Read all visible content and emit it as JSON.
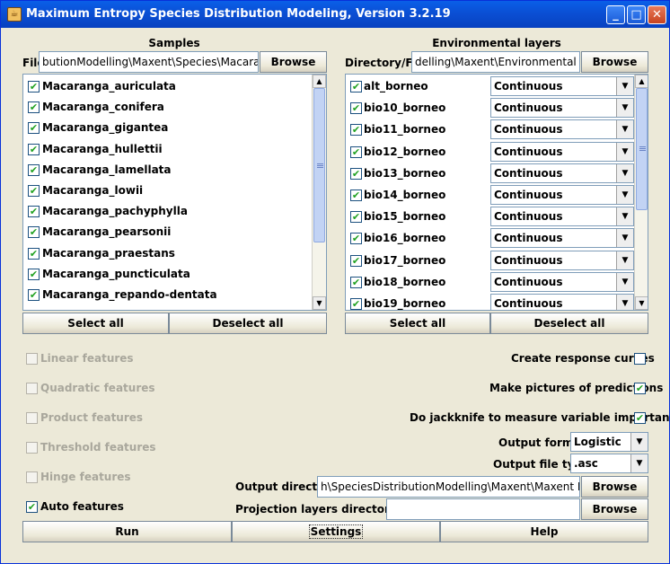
{
  "window": {
    "title": "Maximum Entropy Species Distribution Modeling, Version 3.2.19",
    "title_icon": "java-cup-icon",
    "controls": {
      "minimize": "_",
      "maximize": "□",
      "close": "✕"
    }
  },
  "samples": {
    "title": "Samples",
    "file_label": "File",
    "file_value": "butionModelling\\Maxent\\Species\\Macaranga.c",
    "browse": "Browse",
    "items": [
      "Macaranga_auriculata",
      "Macaranga_conifera",
      "Macaranga_gigantea",
      "Macaranga_hullettii",
      "Macaranga_lamellata",
      "Macaranga_lowii",
      "Macaranga_pachyphylla",
      "Macaranga_pearsonii",
      "Macaranga_praestans",
      "Macaranga_puncticulata",
      "Macaranga_repando-dentata"
    ],
    "select_all": "Select all",
    "deselect_all": "Deselect all"
  },
  "env": {
    "title": "Environmental layers",
    "dir_label": "Directory/File",
    "dir_value": "delling\\Maxent\\Environmental Data",
    "browse": "Browse",
    "items": [
      {
        "name": "alt_borneo",
        "type": "Continuous"
      },
      {
        "name": "bio10_borneo",
        "type": "Continuous"
      },
      {
        "name": "bio11_borneo",
        "type": "Continuous"
      },
      {
        "name": "bio12_borneo",
        "type": "Continuous"
      },
      {
        "name": "bio13_borneo",
        "type": "Continuous"
      },
      {
        "name": "bio14_borneo",
        "type": "Continuous"
      },
      {
        "name": "bio15_borneo",
        "type": "Continuous"
      },
      {
        "name": "bio16_borneo",
        "type": "Continuous"
      },
      {
        "name": "bio17_borneo",
        "type": "Continuous"
      },
      {
        "name": "bio18_borneo",
        "type": "Continuous"
      },
      {
        "name": "bio19_borneo",
        "type": "Continuous"
      }
    ],
    "select_all": "Select all",
    "deselect_all": "Deselect all"
  },
  "features": {
    "linear": {
      "label": "Linear features",
      "checked": false,
      "enabled": false
    },
    "quadratic": {
      "label": "Quadratic features",
      "checked": false,
      "enabled": false
    },
    "product": {
      "label": "Product features",
      "checked": false,
      "enabled": false
    },
    "threshold": {
      "label": "Threshold features",
      "checked": false,
      "enabled": false
    },
    "hinge": {
      "label": "Hinge features",
      "checked": false,
      "enabled": false
    },
    "auto": {
      "label": "Auto features",
      "checked": true,
      "enabled": true
    }
  },
  "options": {
    "response_curves": {
      "label": "Create response curves",
      "checked": false
    },
    "pictures": {
      "label": "Make pictures of predictions",
      "checked": true
    },
    "jackknife": {
      "label": "Do jackknife to measure variable importance",
      "checked": true
    },
    "output_format_label": "Output format",
    "output_format_value": "Logistic",
    "output_file_type_label": "Output file type",
    "output_file_type_value": ".asc",
    "output_dir_label": "Output directory",
    "output_dir_value": "h\\SpeciesDistributionModelling\\Maxent\\Maxent Results",
    "projection_label": "Projection layers directory/file",
    "projection_value": "",
    "browse": "Browse"
  },
  "bottom": {
    "run": "Run",
    "settings": "Settings",
    "help": "Help"
  },
  "checkmark": "✔"
}
